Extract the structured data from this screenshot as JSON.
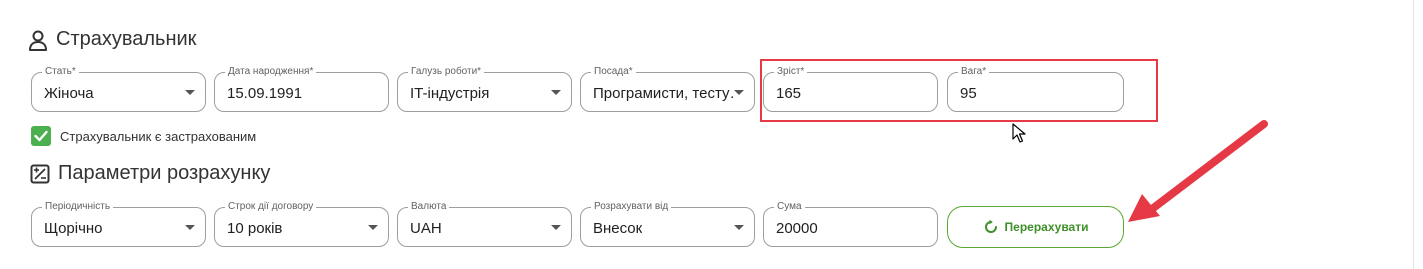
{
  "insurer": {
    "title": "Страхувальник",
    "fields": {
      "gender": {
        "label": "Стать*",
        "value": "Жіноча"
      },
      "birth_date": {
        "label": "Дата народження*",
        "value": "15.09.1991"
      },
      "industry": {
        "label": "Галузь роботи*",
        "value": "IT-індустрія"
      },
      "position": {
        "label": "Посада*",
        "value": "Програмисти, тесту…"
      },
      "height": {
        "label": "Зріст*",
        "value": "165"
      },
      "weight": {
        "label": "Вага*",
        "value": "95"
      }
    },
    "insured_checkbox": {
      "label": "Страхувальник є застрахованим",
      "checked": true
    }
  },
  "calc_params": {
    "title": "Параметри розрахунку",
    "fields": {
      "periodicity": {
        "label": "Періодичність",
        "value": "Щорічно"
      },
      "term": {
        "label": "Строк дії договору",
        "value": "10 років"
      },
      "currency": {
        "label": "Валюта",
        "value": "UAH"
      },
      "calc_from": {
        "label": "Розрахувати від",
        "value": "Внесок"
      },
      "sum": {
        "label": "Сума",
        "value": "20000"
      }
    },
    "recalc_button": "Перерахувати"
  },
  "colors": {
    "accent_green": "#4caf50",
    "highlight_red": "#e53945"
  },
  "icons": [
    "person-icon",
    "calculator-icon",
    "checkmark-icon",
    "refresh-icon",
    "chevron-down-icon",
    "mouse-cursor-icon"
  ]
}
